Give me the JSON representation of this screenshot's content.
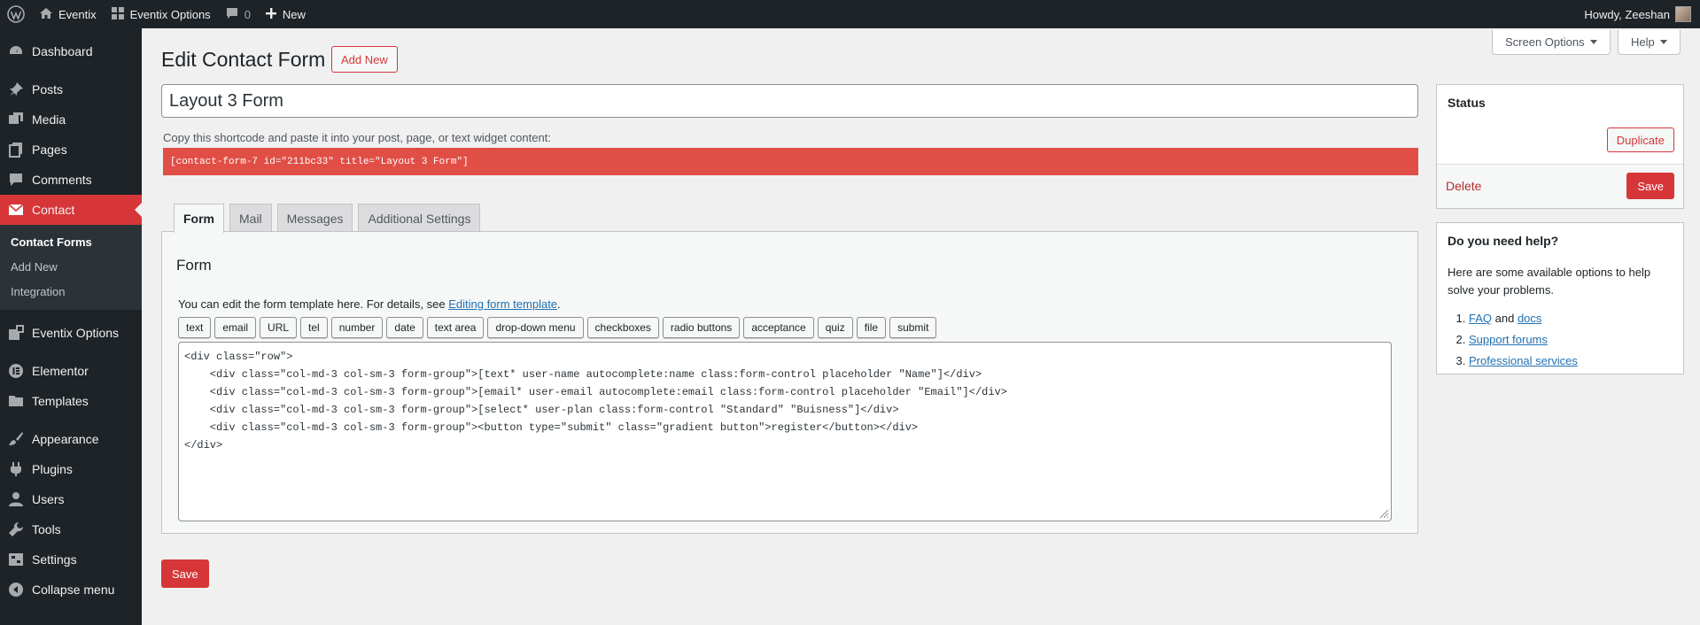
{
  "adminbar": {
    "site_name": "Eventix",
    "options_label": "Eventix Options",
    "comments_count": "0",
    "new_label": "New",
    "greeting": "Howdy, Zeeshan"
  },
  "sidebar": {
    "items": [
      {
        "label": "Dashboard"
      },
      {
        "label": "Posts"
      },
      {
        "label": "Media"
      },
      {
        "label": "Pages"
      },
      {
        "label": "Comments"
      },
      {
        "label": "Contact"
      },
      {
        "label": "Eventix Options"
      },
      {
        "label": "Elementor"
      },
      {
        "label": "Templates"
      },
      {
        "label": "Appearance"
      },
      {
        "label": "Plugins"
      },
      {
        "label": "Users"
      },
      {
        "label": "Tools"
      },
      {
        "label": "Settings"
      },
      {
        "label": "Collapse menu"
      }
    ],
    "submenu": [
      "Contact Forms",
      "Add New",
      "Integration"
    ]
  },
  "screen_options": {
    "screen_label": "Screen Options",
    "help_label": "Help"
  },
  "page": {
    "title": "Edit Contact Form",
    "add_new_label": "Add New",
    "form_title": "Layout 3 Form",
    "shortcode_hint": "Copy this shortcode and paste it into your post, page, or text widget content:",
    "shortcode": "[contact-form-7 id=\"211bc33\" title=\"Layout 3 Form\"]",
    "save_label": "Save"
  },
  "tabs": [
    {
      "label": "Form"
    },
    {
      "label": "Mail"
    },
    {
      "label": "Messages"
    },
    {
      "label": "Additional Settings"
    }
  ],
  "form_panel": {
    "heading": "Form",
    "desc_prefix": "You can edit the form template here. For details, see ",
    "desc_link": "Editing form template",
    "desc_suffix": ".",
    "tag_buttons": [
      "text",
      "email",
      "URL",
      "tel",
      "number",
      "date",
      "text area",
      "drop-down menu",
      "checkboxes",
      "radio buttons",
      "acceptance",
      "quiz",
      "file",
      "submit"
    ],
    "code": "<div class=\"row\">\n    <div class=\"col-md-3 col-sm-3 form-group\">[text* user-name autocomplete:name class:form-control placeholder \"Name\"]</div>\n    <div class=\"col-md-3 col-sm-3 form-group\">[email* user-email autocomplete:email class:form-control placeholder \"Email\"]</div>\n    <div class=\"col-md-3 col-sm-3 form-group\">[select* user-plan class:form-control \"Standard\" \"Buisness\"]</div>\n    <div class=\"col-md-3 col-sm-3 form-group\"><button type=\"submit\" class=\"gradient button\">register</button></div>\n</div>"
  },
  "status_box": {
    "heading": "Status",
    "duplicate_label": "Duplicate",
    "delete_label": "Delete",
    "save_label": "Save"
  },
  "help_box": {
    "heading": "Do you need help?",
    "text": "Here are some available options to help solve your problems.",
    "faq": "FAQ",
    "and": " and ",
    "docs": "docs",
    "support": "Support forums",
    "services": "Professional services"
  },
  "colors": {
    "accent": "#d63638",
    "sidebar_bg": "#1d2327",
    "shortcode_bg": "#e04e45",
    "link": "#2271b1"
  }
}
